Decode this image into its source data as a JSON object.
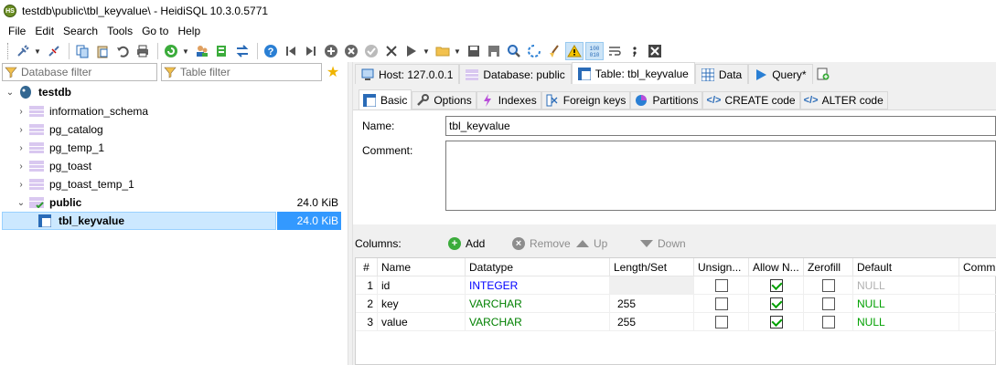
{
  "window": {
    "title": "testdb\\public\\tbl_keyvalue\\ - HeidiSQL 10.3.0.5771",
    "app_icon_text": "HS"
  },
  "menu": [
    "File",
    "Edit",
    "Search",
    "Tools",
    "Go to",
    "Help"
  ],
  "filters": {
    "database_placeholder": "Database filter",
    "table_placeholder": "Table filter"
  },
  "tree": {
    "root": "testdb",
    "items": [
      {
        "label": "information_schema"
      },
      {
        "label": "pg_catalog"
      },
      {
        "label": "pg_temp_1"
      },
      {
        "label": "pg_toast"
      },
      {
        "label": "pg_toast_temp_1"
      },
      {
        "label": "public",
        "size": "24.0 KiB"
      },
      {
        "label": "tbl_keyvalue",
        "size": "24.0 KiB"
      }
    ]
  },
  "main_tabs": [
    {
      "label": "Host: 127.0.0.1"
    },
    {
      "label": "Database: public"
    },
    {
      "label": "Table: tbl_keyvalue"
    },
    {
      "label": "Data"
    },
    {
      "label": "Query*"
    }
  ],
  "sub_tabs": [
    {
      "label": "Basic"
    },
    {
      "label": "Options"
    },
    {
      "label": "Indexes"
    },
    {
      "label": "Foreign keys"
    },
    {
      "label": "Partitions"
    },
    {
      "label": "CREATE code"
    },
    {
      "label": "ALTER code"
    }
  ],
  "basic": {
    "name_label": "Name:",
    "name_value": "tbl_keyvalue",
    "comment_label": "Comment:",
    "comment_value": ""
  },
  "columns_bar": {
    "label": "Columns:",
    "add": "Add",
    "remove": "Remove",
    "up": "Up",
    "down": "Down"
  },
  "grid": {
    "headers": [
      "#",
      "Name",
      "Datatype",
      "Length/Set",
      "Unsign...",
      "Allow N...",
      "Zerofill",
      "Default",
      "Comm"
    ],
    "rows": [
      {
        "num": "1",
        "name": "id",
        "datatype": "INTEGER",
        "length": "",
        "unsigned": false,
        "allow_null": true,
        "zerofill": false,
        "default": "NULL"
      },
      {
        "num": "2",
        "name": "key",
        "datatype": "VARCHAR",
        "length": "255",
        "unsigned": false,
        "allow_null": true,
        "zerofill": false,
        "default": "NULL"
      },
      {
        "num": "3",
        "name": "value",
        "datatype": "VARCHAR",
        "length": "255",
        "unsigned": false,
        "allow_null": true,
        "zerofill": false,
        "default": "NULL"
      }
    ]
  },
  "colors": {
    "selection": "#cce8ff",
    "size_highlight": "#3399ff",
    "varchar": "#008000",
    "integer": "#0000ff"
  }
}
